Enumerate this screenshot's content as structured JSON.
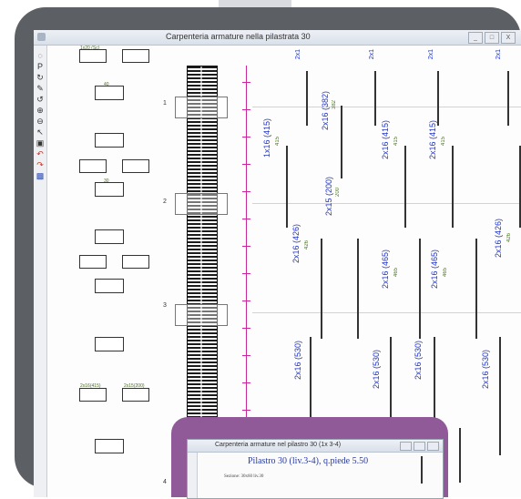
{
  "window": {
    "title": "Carpenteria armature nella pilastrata 30",
    "controls": [
      "_",
      "□",
      "X"
    ]
  },
  "toolbar": {
    "tools": [
      "◌",
      "P",
      "↻",
      "✎",
      "↺",
      "⊕",
      "⊖",
      "↖",
      "▣",
      "↶",
      "↷",
      "▩"
    ]
  },
  "drawing": {
    "levels": [
      "1",
      "2",
      "3",
      "4"
    ],
    "section_labels": [
      "1x20 (Sc)",
      "40",
      "30",
      "2x16(415)",
      "2x15(200)"
    ],
    "rebar_labels": [
      "1x16 (415)",
      "2x16 (382)",
      "2x16 (415)",
      "2x16 (415)",
      "2x15 (200)",
      "2x16 (426)",
      "2x16 (465)",
      "2x16 (465)",
      "2x16 (426)",
      "2x16 (530)",
      "2x16 (530)",
      "2x16 (530)",
      "2x16 (530)"
    ],
    "top_marks": [
      "2x1",
      "2x1",
      "2x1",
      "2x1"
    ],
    "green_marks": [
      "415",
      "382",
      "415",
      "415",
      "200",
      "426",
      "465",
      "465",
      "426"
    ]
  },
  "inset": {
    "title": "Carpenteria armature nel pilastro 30 (1x 3-4)",
    "heading": "Pilastro 30 (liv.3-4), q.piede 5.50",
    "subtext": "Sezione: 30x60 liv.30"
  },
  "colors": {
    "frame": "#5c5f64",
    "inset_frame": "#8f5a97",
    "axis": "#c8289a",
    "rebar_label": "#2235c0",
    "length_label": "#4f7a22"
  }
}
